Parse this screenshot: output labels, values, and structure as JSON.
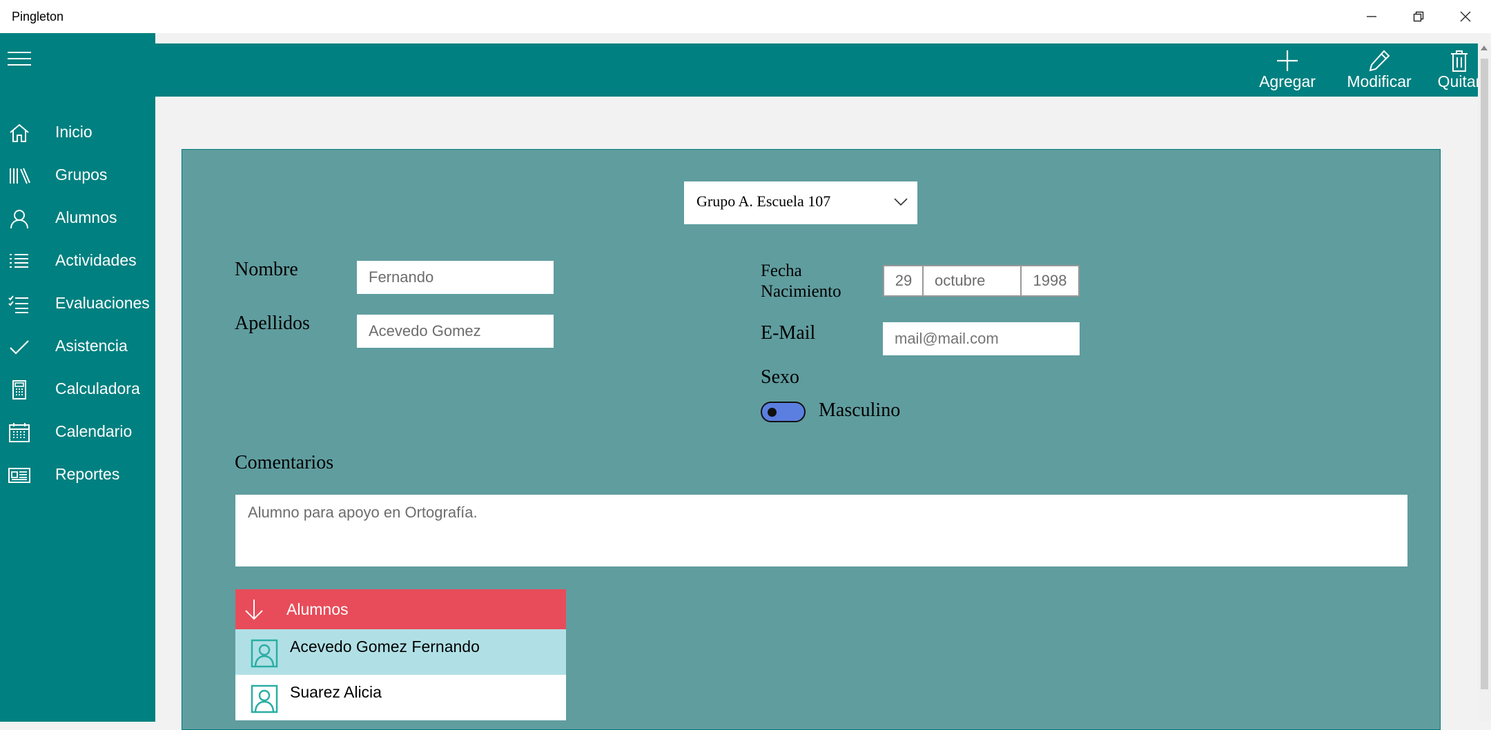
{
  "app": {
    "title": "Pingleton"
  },
  "window_controls": {
    "minimize_icon": "minimize-icon",
    "restore_icon": "restore-icon",
    "close_icon": "close-icon"
  },
  "colors": {
    "teal": "#008080",
    "panel": "#609d9f",
    "accent_red": "#e84c5a",
    "selected_row": "#b0e0e6",
    "toggle": "#5b7fe0"
  },
  "sidebar": {
    "menu_icon": "hamburger-icon",
    "items": [
      {
        "label": "Inicio",
        "icon": "home-icon"
      },
      {
        "label": "Grupos",
        "icon": "library-icon"
      },
      {
        "label": "Alumnos",
        "icon": "person-icon"
      },
      {
        "label": "Actividades",
        "icon": "list-icon"
      },
      {
        "label": "Evaluaciones",
        "icon": "checklist-icon"
      },
      {
        "label": "Asistencia",
        "icon": "checkmark-icon"
      },
      {
        "label": "Calculadora",
        "icon": "calculator-icon"
      },
      {
        "label": "Calendario",
        "icon": "calendar-icon"
      },
      {
        "label": "Reportes",
        "icon": "report-icon"
      }
    ]
  },
  "toolbar": {
    "add_label": "Agregar",
    "edit_label": "Modificar",
    "delete_label": "Quitar"
  },
  "form": {
    "group_selected": "Grupo A. Escuela 107",
    "nombre_label": "Nombre",
    "nombre_value": "Fernando",
    "apellidos_label": "Apellidos",
    "apellidos_value": "Acevedo Gomez",
    "fecha_label_line1": "Fecha",
    "fecha_label_line2": "Nacimiento",
    "fecha_day": "29",
    "fecha_month": "octubre",
    "fecha_year": "1998",
    "email_label": "E-Mail",
    "email_placeholder": "mail@mail.com",
    "sexo_label": "Sexo",
    "sexo_value": "Masculino",
    "comentarios_label": "Comentarios",
    "comentarios_value": "Alumno para apoyo en Ortografía."
  },
  "students": {
    "header": "Alumnos",
    "items": [
      {
        "name": "Acevedo Gomez Fernando",
        "selected": true
      },
      {
        "name": "Suarez Alicia",
        "selected": false
      }
    ]
  }
}
